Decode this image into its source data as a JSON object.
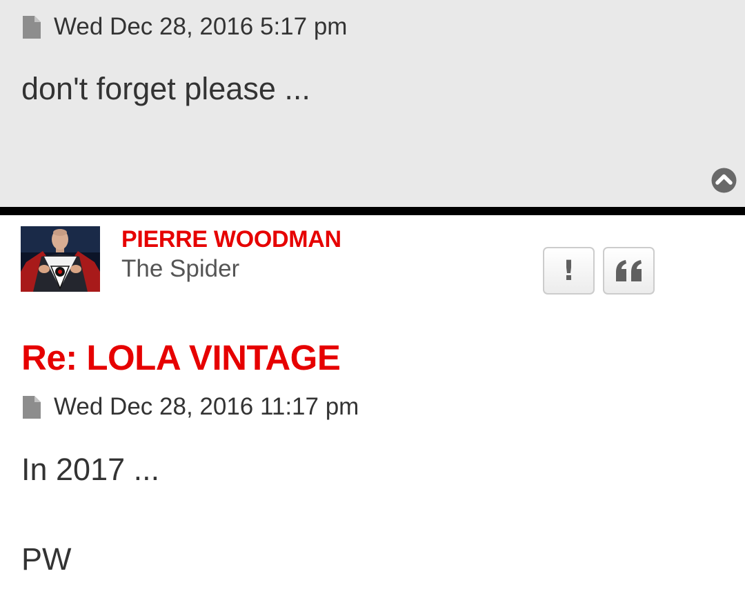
{
  "previous_post": {
    "timestamp": "Wed Dec 28, 2016 5:17 pm",
    "body": "don't forget please ...",
    "time_icon": "post-document-icon",
    "top_icon": "chevron-up-circle-icon"
  },
  "post": {
    "author": {
      "name": "PIERRE WOODMAN",
      "rank": "The Spider",
      "avatar_icon": "avatar-image"
    },
    "buttons": {
      "report": {
        "label": "!",
        "icon": "exclamation-icon"
      },
      "quote": {
        "icon": "quote-icon"
      }
    },
    "title": "Re: LOLA VINTAGE",
    "timestamp": "Wed Dec 28, 2016 11:17 pm",
    "time_icon": "post-document-icon",
    "body_lines": [
      "In 2017 ...",
      "PW"
    ]
  },
  "colors": {
    "accent": "#e60000",
    "text": "#333333",
    "muted": "#555555",
    "prev_post_bg": "#e9e9e9",
    "separator": "#000000"
  }
}
